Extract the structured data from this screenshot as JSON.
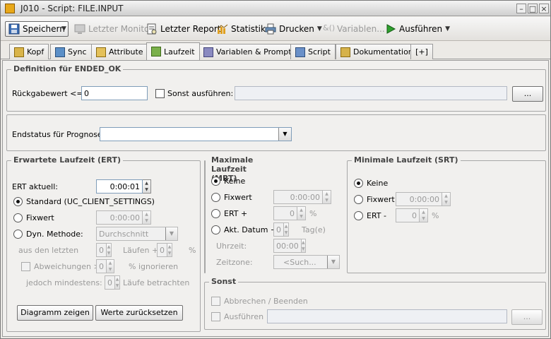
{
  "window": {
    "title": "J010 - Script: FILE.INPUT"
  },
  "toolbar": {
    "save": "Speichern",
    "last_monitor": "Letzter Monitor",
    "last_report": "Letzter Report",
    "statistics": "Statistik",
    "print": "Drucken",
    "variables": "Variablen...",
    "execute": "Ausführen"
  },
  "tabs": [
    "Kopf",
    "Sync",
    "Attribute",
    "Laufzeit",
    "Variablen & Prompts",
    "Script",
    "Dokumentation",
    "[+]"
  ],
  "ended_ok": {
    "legend": "Definition für ENDED_OK",
    "return_label": "Rückgabewert <=:",
    "return_value": "0",
    "else_label": "Sonst ausführen:",
    "browse": "..."
  },
  "prognosis": {
    "label": "Endstatus für Prognose:",
    "value": ""
  },
  "ert": {
    "legend": "Erwartete Laufzeit (ERT)",
    "current_label": "ERT aktuell:",
    "current_value": "0:00:01",
    "standard": "Standard (UC_CLIENT_SETTINGS)",
    "fixed": "Fixwert",
    "fixed_value": "0:00:00",
    "dyn": "Dyn. Methode:",
    "dyn_value": "Durchschnitt",
    "last_label": "aus den letzten",
    "runs_val": "0",
    "runs_label": "Läufen +",
    "pct_val": "0",
    "pct": "%",
    "dev_label": "Abweichungen >",
    "dev_val": "0",
    "dev_suffix": "% ignorieren",
    "min_label": "jedoch mindestens:",
    "min_val": "0",
    "min_suffix": "Läufe betrachten",
    "chart_btn": "Diagramm zeigen",
    "reset_btn": "Werte zurücksetzen"
  },
  "mrt": {
    "legend": "Maximale Laufzeit (MRT)",
    "none": "Keine",
    "fixed": "Fixwert",
    "fixed_value": "0:00:00",
    "ert_plus": "ERT +",
    "ert_val": "0",
    "pct": "%",
    "date": "Akt. Datum +",
    "day_val": "0",
    "day_label": "Tag(e)",
    "time_label": "Uhrzeit:",
    "time_val": "00:00",
    "tz_label": "Zeitzone:",
    "tz_placeholder": "<Such..."
  },
  "srt": {
    "legend": "Minimale Laufzeit (SRT)",
    "none": "Keine",
    "fixed": "Fixwert",
    "fixed_value": "0:00:00",
    "ert_minus": "ERT -",
    "ert_val": "0",
    "pct": "%"
  },
  "else": {
    "legend": "Sonst",
    "abort": "Abbrechen / Beenden",
    "execute": "Ausführen",
    "browse": "..."
  }
}
